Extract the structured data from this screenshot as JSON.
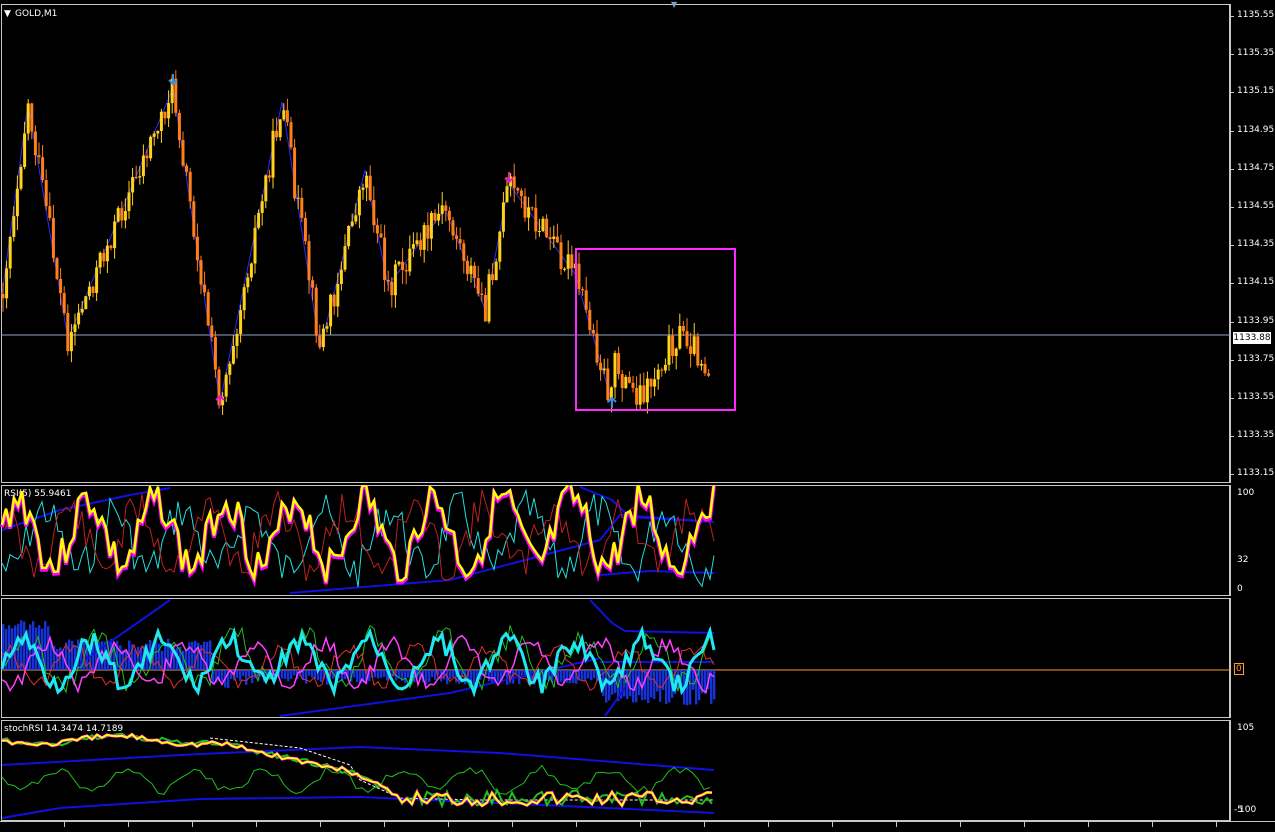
{
  "main": {
    "title": "GOLD,M1",
    "current_price": "1133.88",
    "y_labels": [
      "1135.55",
      "1135.35",
      "1135.15",
      "1134.95",
      "1134.75",
      "1134.55",
      "1134.35",
      "1134.15",
      "1133.95",
      "1133.75",
      "1133.55",
      "1133.35",
      "1133.15"
    ]
  },
  "rsi": {
    "title": "RSI(5) 55.9461",
    "y_labels": [
      "100",
      "32",
      "0"
    ]
  },
  "osc": {
    "y_label": "0"
  },
  "stoch": {
    "title": "stochRSI 14.3474 14.7189",
    "y_labels": [
      "105",
      "-5",
      "100"
    ]
  },
  "colors": {
    "bull_candle": "#ffd21a",
    "bear_candle": "#ff7f1a",
    "zigzag": "#2a2aff",
    "box": "#ff29ff",
    "arrow_up_blue": "#3a8fe0",
    "arrow_magenta": "#e020c0",
    "band": "#1010e0",
    "rsi_yellow": "#ffff00",
    "rsi_magenta": "#ff00ff",
    "osc_cyan": "#20e8f0",
    "osc_hist": "#1a3cff"
  }
}
